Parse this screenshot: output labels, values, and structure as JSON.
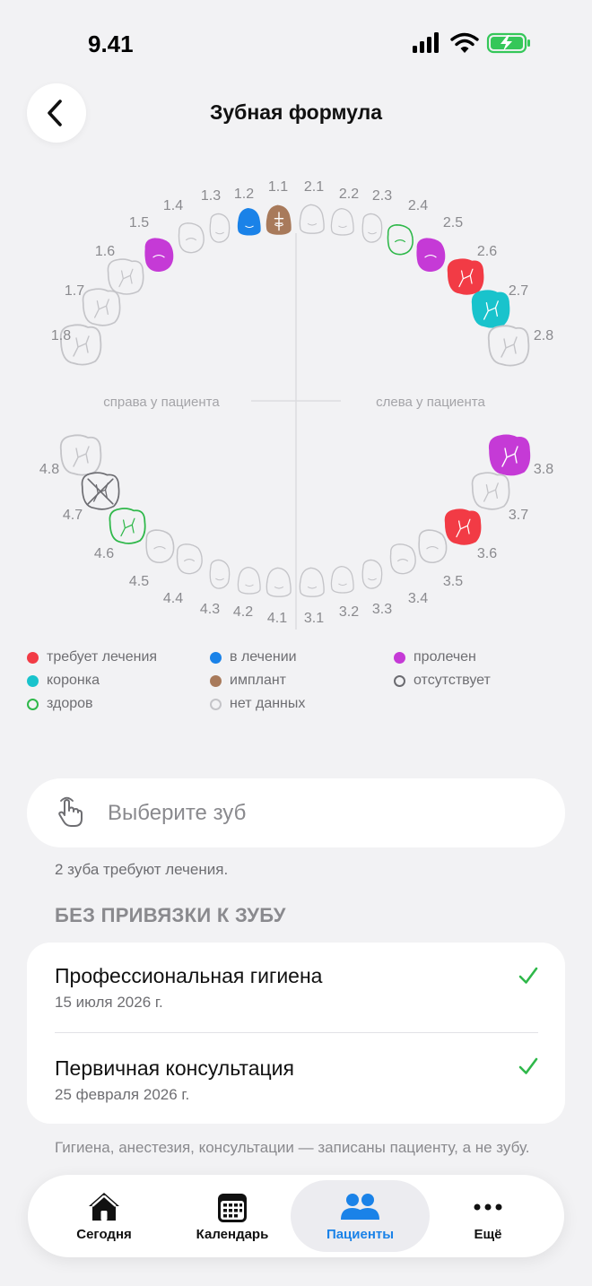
{
  "status_bar": {
    "time": "9.41"
  },
  "header": {
    "title": "Зубная формула"
  },
  "jaw": {
    "right_side_label": "справа у пациента",
    "left_side_label": "слева у пациента",
    "teeth": [
      {
        "num": "1.8",
        "status": "none",
        "shape": "molar"
      },
      {
        "num": "1.7",
        "status": "none",
        "shape": "molar"
      },
      {
        "num": "1.6",
        "status": "none",
        "shape": "molar"
      },
      {
        "num": "1.5",
        "status": "treated",
        "shape": "premolar"
      },
      {
        "num": "1.4",
        "status": "none",
        "shape": "premolar"
      },
      {
        "num": "1.3",
        "status": "none",
        "shape": "canine"
      },
      {
        "num": "1.2",
        "status": "in_treatment",
        "shape": "incisor"
      },
      {
        "num": "1.1",
        "status": "implant",
        "shape": "incisor"
      },
      {
        "num": "2.1",
        "status": "none",
        "shape": "incisor"
      },
      {
        "num": "2.2",
        "status": "none",
        "shape": "incisor"
      },
      {
        "num": "2.3",
        "status": "none",
        "shape": "canine"
      },
      {
        "num": "2.4",
        "status": "healthy",
        "shape": "premolar"
      },
      {
        "num": "2.5",
        "status": "treated",
        "shape": "premolar"
      },
      {
        "num": "2.6",
        "status": "needs_treatment",
        "shape": "molar"
      },
      {
        "num": "2.7",
        "status": "crown",
        "shape": "molar"
      },
      {
        "num": "2.8",
        "status": "none",
        "shape": "molar"
      },
      {
        "num": "4.8",
        "status": "none",
        "shape": "molar"
      },
      {
        "num": "4.7",
        "status": "missing",
        "shape": "molar"
      },
      {
        "num": "4.6",
        "status": "healthy",
        "shape": "molar"
      },
      {
        "num": "4.5",
        "status": "none",
        "shape": "premolar"
      },
      {
        "num": "4.4",
        "status": "none",
        "shape": "premolar"
      },
      {
        "num": "4.3",
        "status": "none",
        "shape": "canine"
      },
      {
        "num": "4.2",
        "status": "none",
        "shape": "incisor"
      },
      {
        "num": "4.1",
        "status": "none",
        "shape": "incisor"
      },
      {
        "num": "3.1",
        "status": "none",
        "shape": "incisor"
      },
      {
        "num": "3.2",
        "status": "none",
        "shape": "incisor"
      },
      {
        "num": "3.3",
        "status": "none",
        "shape": "canine"
      },
      {
        "num": "3.4",
        "status": "none",
        "shape": "premolar"
      },
      {
        "num": "3.5",
        "status": "none",
        "shape": "premolar"
      },
      {
        "num": "3.6",
        "status": "needs_treatment",
        "shape": "molar"
      },
      {
        "num": "3.7",
        "status": "none",
        "shape": "molar"
      },
      {
        "num": "3.8",
        "status": "treated",
        "shape": "molar"
      }
    ]
  },
  "legend": [
    {
      "key": "needs_treatment",
      "label": "требует лечения",
      "color": "#f23b45",
      "style": "filled"
    },
    {
      "key": "in_treatment",
      "label": "в лечении",
      "color": "#1a82e8",
      "style": "filled"
    },
    {
      "key": "treated",
      "label": "пролечен",
      "color": "#c53ad6",
      "style": "filled"
    },
    {
      "key": "crown",
      "label": "коронка",
      "color": "#19c3cc",
      "style": "filled"
    },
    {
      "key": "implant",
      "label": "имплант",
      "color": "#a87a5b",
      "style": "filled"
    },
    {
      "key": "missing",
      "label": "отсутствует",
      "color": "#6b6b70",
      "style": "outline"
    },
    {
      "key": "healthy",
      "label": "здоров",
      "color": "#2fb84a",
      "style": "outline"
    },
    {
      "key": "none",
      "label": "нет данных",
      "color": "#c4c4c8",
      "style": "outline"
    }
  ],
  "search": {
    "placeholder": "Выберите зуб",
    "value": "",
    "icon": "hand-pointer-icon"
  },
  "hint": "2 зуба требуют лечения.",
  "section": {
    "title": "БЕЗ ПРИВЯЗКИ К ЗУБУ",
    "items": [
      {
        "title": "Профессиональная гигиена",
        "date": "15 июля 2026 г.",
        "done": true
      },
      {
        "title": "Первичная консультация",
        "date": "25 февраля 2026 г.",
        "done": true
      }
    ],
    "footnote": "Гигиена, анестезия, консультации — записаны пациенту, а не зубу."
  },
  "tabbar": {
    "tabs": [
      {
        "key": "today",
        "label": "Сегодня",
        "icon": "house-icon",
        "active": false
      },
      {
        "key": "calendar",
        "label": "Календарь",
        "icon": "calendar-icon",
        "active": false
      },
      {
        "key": "patients",
        "label": "Пациенты",
        "icon": "people-icon",
        "active": true
      },
      {
        "key": "more",
        "label": "Ещё",
        "icon": "ellipsis-icon",
        "active": false
      }
    ]
  },
  "colors": {
    "accent": "#1a82e8",
    "check": "#2fb84a",
    "background": "#f2f2f4"
  }
}
